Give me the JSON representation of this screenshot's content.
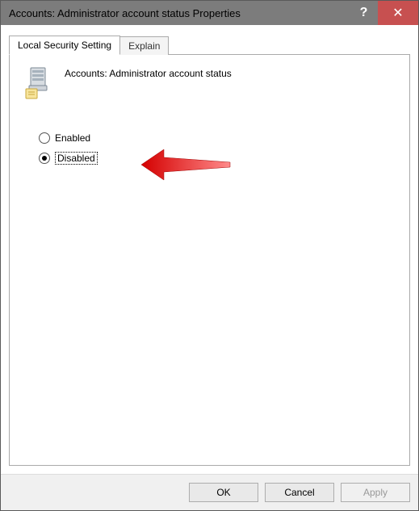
{
  "window": {
    "title": "Accounts: Administrator account status Properties"
  },
  "tabs": {
    "active": "Local Security Setting",
    "inactive": "Explain"
  },
  "policy": {
    "title": "Accounts: Administrator account status"
  },
  "options": {
    "enabled_label": "Enabled",
    "disabled_label": "Disabled",
    "selected": "disabled"
  },
  "buttons": {
    "ok": "OK",
    "cancel": "Cancel",
    "apply": "Apply"
  },
  "icons": {
    "help": "?",
    "close": "✕"
  }
}
